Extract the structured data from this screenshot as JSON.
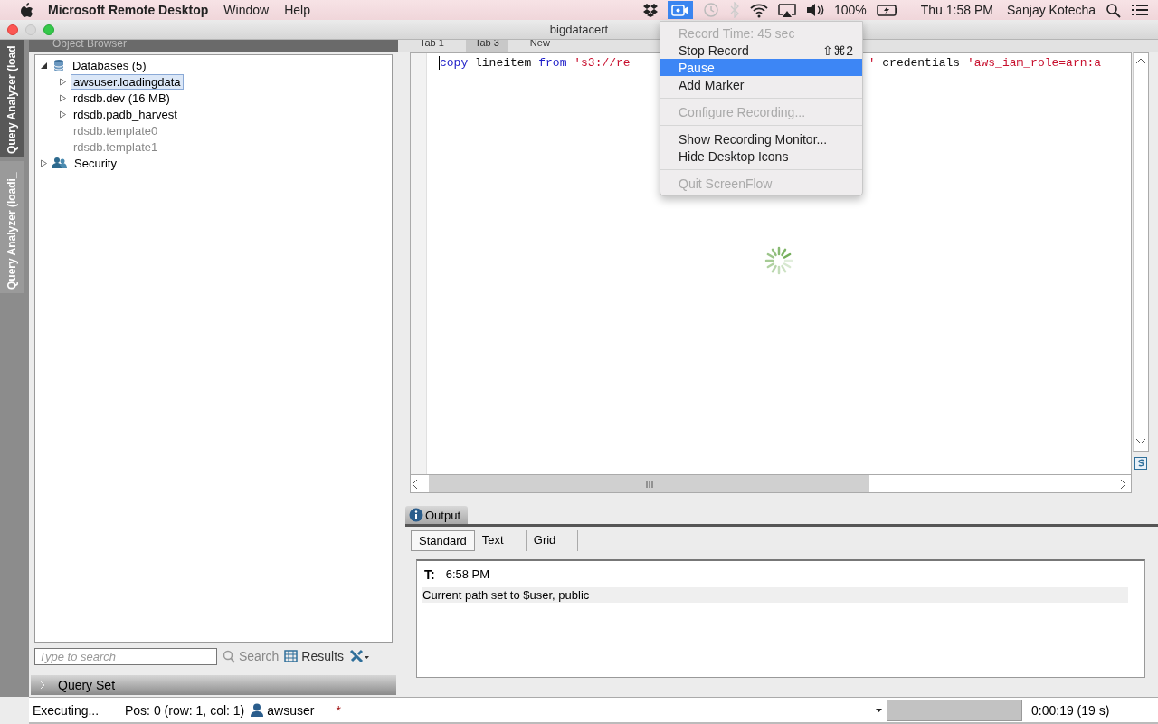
{
  "menubar": {
    "app_name": "Microsoft Remote Desktop",
    "menus": [
      "Window",
      "Help"
    ],
    "recorder_active": true,
    "battery": "100%",
    "clock": "Thu 1:58 PM",
    "user": "Sanjay Kotecha"
  },
  "window": {
    "title": "bigdatacert"
  },
  "side_tabs": [
    "Query Analyzer (load",
    "Query Analyzer (loadi_"
  ],
  "object_browser": {
    "title": "Object Browser",
    "tree": [
      {
        "label": "Databases (5)",
        "kind": "database",
        "expanded": true,
        "selected": false,
        "dimmed": false,
        "children": [
          {
            "label": "awsuser.loadingdata",
            "kind": "node",
            "expanded": false,
            "selected": true,
            "dimmed": false
          },
          {
            "label": "rdsdb.dev (16 MB)",
            "kind": "node",
            "expanded": false,
            "selected": false,
            "dimmed": false
          },
          {
            "label": "rdsdb.padb_harvest",
            "kind": "node",
            "expanded": false,
            "selected": false,
            "dimmed": false
          },
          {
            "label": "rdsdb.template0",
            "kind": "leaf",
            "selected": false,
            "dimmed": true
          },
          {
            "label": "rdsdb.template1",
            "kind": "leaf",
            "selected": false,
            "dimmed": true
          }
        ]
      },
      {
        "label": "Security",
        "kind": "users",
        "expanded": false,
        "selected": false,
        "dimmed": false
      }
    ],
    "search": {
      "placeholder": "Type to search"
    },
    "search_button": "Search",
    "results_button": "Results",
    "query_set": "Query Set"
  },
  "editor": {
    "tabs": [
      {
        "label": "Tab 1",
        "selected": false
      },
      {
        "label": "Tab 3",
        "selected": true
      },
      {
        "label": "New",
        "selected": false
      }
    ],
    "code_parts": [
      [
        {
          "kind": "keyword",
          "text": "copy"
        },
        {
          "kind": "plain",
          "text": "lineitem"
        },
        {
          "kind": "keyword",
          "text": "from"
        },
        {
          "kind": "string",
          "text": "'s3://re"
        }
      ],
      [
        {
          "kind": "string",
          "text": "'"
        },
        {
          "kind": "plain",
          "text": "credentials"
        },
        {
          "kind": "string",
          "text": "'aws_iam_role=arn:a"
        }
      ]
    ],
    "loading": true
  },
  "recording_menu": [
    {
      "kind": "item",
      "label": "Record Time: 45 sec",
      "disabled": true,
      "selected": false
    },
    {
      "kind": "item",
      "label": "Stop Record",
      "shortcut": "⇧⌘2",
      "disabled": false,
      "selected": false
    },
    {
      "kind": "item",
      "label": "Pause",
      "disabled": false,
      "selected": true
    },
    {
      "kind": "item",
      "label": "Add Marker",
      "disabled": false,
      "selected": false
    },
    {
      "kind": "separator"
    },
    {
      "kind": "item",
      "label": "Configure Recording...",
      "disabled": true,
      "selected": false
    },
    {
      "kind": "separator"
    },
    {
      "kind": "item",
      "label": "Show Recording Monitor...",
      "disabled": false,
      "selected": false
    },
    {
      "kind": "item",
      "label": "Hide Desktop Icons",
      "disabled": false,
      "selected": false
    },
    {
      "kind": "separator"
    },
    {
      "kind": "item",
      "label": "Quit ScreenFlow",
      "disabled": true,
      "selected": false
    }
  ],
  "output": {
    "title": "Output",
    "tabs": [
      {
        "label": "Standard",
        "selected": true
      },
      {
        "label": "Text",
        "selected": false
      },
      {
        "label": "Grid",
        "selected": false
      }
    ],
    "time_label": "T:",
    "time": "6:58 PM",
    "message": "Current path set to $user, public"
  },
  "status_bar": {
    "state": "Executing...",
    "position": "Pos: 0 (row: 1, col: 1)",
    "user": "awsuser",
    "modified": "*",
    "progress": {
      "level": 1
    },
    "elapsed": "0:00:19 (19 s)"
  }
}
